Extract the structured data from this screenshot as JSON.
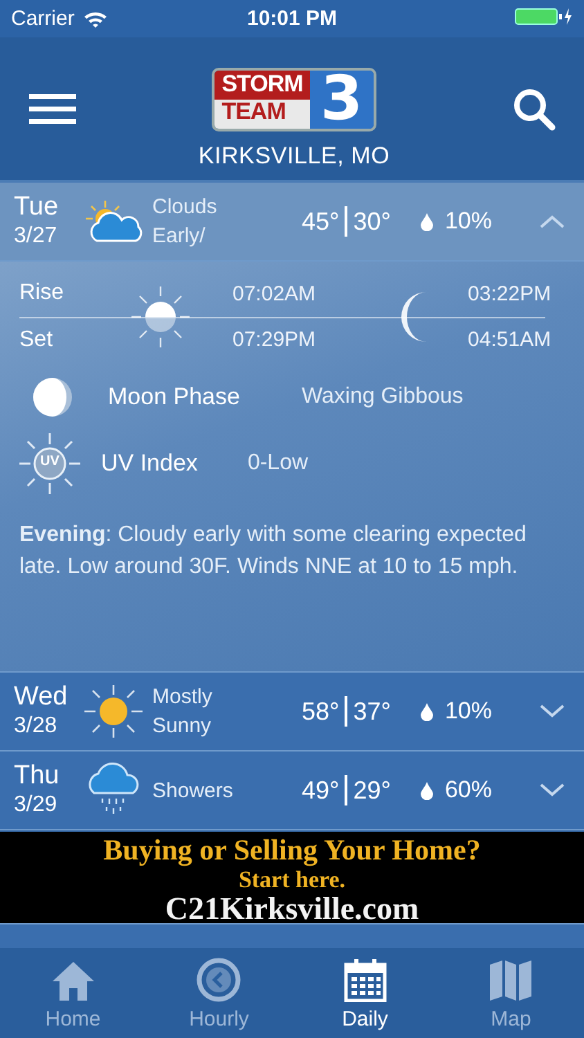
{
  "status_bar": {
    "carrier": "Carrier",
    "time": "10:01 PM"
  },
  "header": {
    "logo": {
      "line_1": "STORM",
      "line_2": "TEAM",
      "number": "3"
    },
    "location": "KIRKSVILLE, MO"
  },
  "days": [
    {
      "day": "Tue",
      "date": "3/27",
      "kind": "partly-cloudy",
      "condition": [
        "Clouds",
        "Early/"
      ],
      "high": "45°",
      "low": "30°",
      "precip": "10%",
      "expanded": true,
      "details": {
        "rise_label": "Rise",
        "set_label": "Set",
        "sunrise": "07:02AM",
        "sunset": "07:29PM",
        "moonrise": "03:22PM",
        "moonset": "04:51AM",
        "moon_phase_label": "Moon Phase",
        "moon_phase": "Waxing Gibbous",
        "uv_label": "UV Index",
        "uv_badge": "UV",
        "uv_value": "0-Low",
        "summary": "**Evening**: Cloudy early with some clearing expected late. Low around 30F. Winds NNE at 10 to 15 mph."
      }
    },
    {
      "day": "Wed",
      "date": "3/28",
      "kind": "sunny",
      "condition": [
        "Mostly",
        "Sunny"
      ],
      "high": "58°",
      "low": "37°",
      "precip": "10%",
      "expanded": false
    },
    {
      "day": "Thu",
      "date": "3/29",
      "kind": "showers",
      "condition": [
        "Showers"
      ],
      "high": "49°",
      "low": "29°",
      "precip": "60%",
      "expanded": false
    }
  ],
  "ad": {
    "headline": "Buying or Selling Your Home?",
    "subline": "Start here.",
    "url": "C21Kirksville.com"
  },
  "tabs": [
    {
      "label": "Home",
      "selected": false
    },
    {
      "label": "Hourly",
      "selected": false
    },
    {
      "label": "Daily",
      "selected": true
    },
    {
      "label": "Map",
      "selected": false
    }
  ]
}
